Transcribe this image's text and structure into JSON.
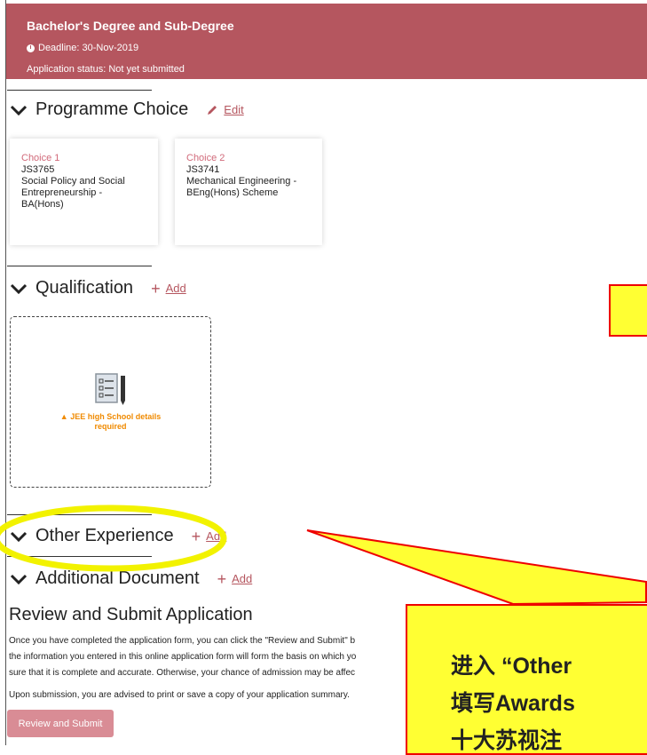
{
  "banner": {
    "title": "Bachelor's Degree and Sub-Degree",
    "deadline": "Deadline: 30-Nov-2019",
    "status": "Application status: Not yet submitted",
    "color": "#b5565f"
  },
  "sections": {
    "programme": {
      "label": "Programme Choice",
      "action": "Edit"
    },
    "qualification": {
      "label": "Qualification",
      "action": "Add"
    },
    "other": {
      "label": "Other Experience",
      "action": "Add"
    },
    "additional": {
      "label": "Additional Document",
      "action": "Add"
    }
  },
  "choices": [
    {
      "label": "Choice 1",
      "code": "JS3765",
      "programme_lines": [
        "Social Policy and Social",
        "Entrepreneurship -",
        "BA(Hons)"
      ]
    },
    {
      "label": "Choice 2",
      "code": "JS3741",
      "programme_lines": [
        "Mechanical Engineering -",
        "BEng(Hons) Scheme"
      ]
    }
  ],
  "qualification_box": {
    "warning_lines": [
      "JEE high School details",
      "required"
    ]
  },
  "review": {
    "title": "Review and Submit Application",
    "paragraph_lines": [
      "Once you have completed the application form, you can click the \"Review and Submit\" b",
      "the information you entered in this online application form will form the basis on which yo",
      "sure that it is complete and accurate. Otherwise, your chance of admission may be affec"
    ],
    "paragraph2": "Upon submission, you are advised to print or save a copy of your application summary.",
    "button": "Review and Submit"
  },
  "annotation": {
    "lines": [
      "进入 “Other",
      "填写Awards",
      "十大苏视注"
    ],
    "highlight_color": "#ffff33",
    "border_color": "#e00000"
  }
}
